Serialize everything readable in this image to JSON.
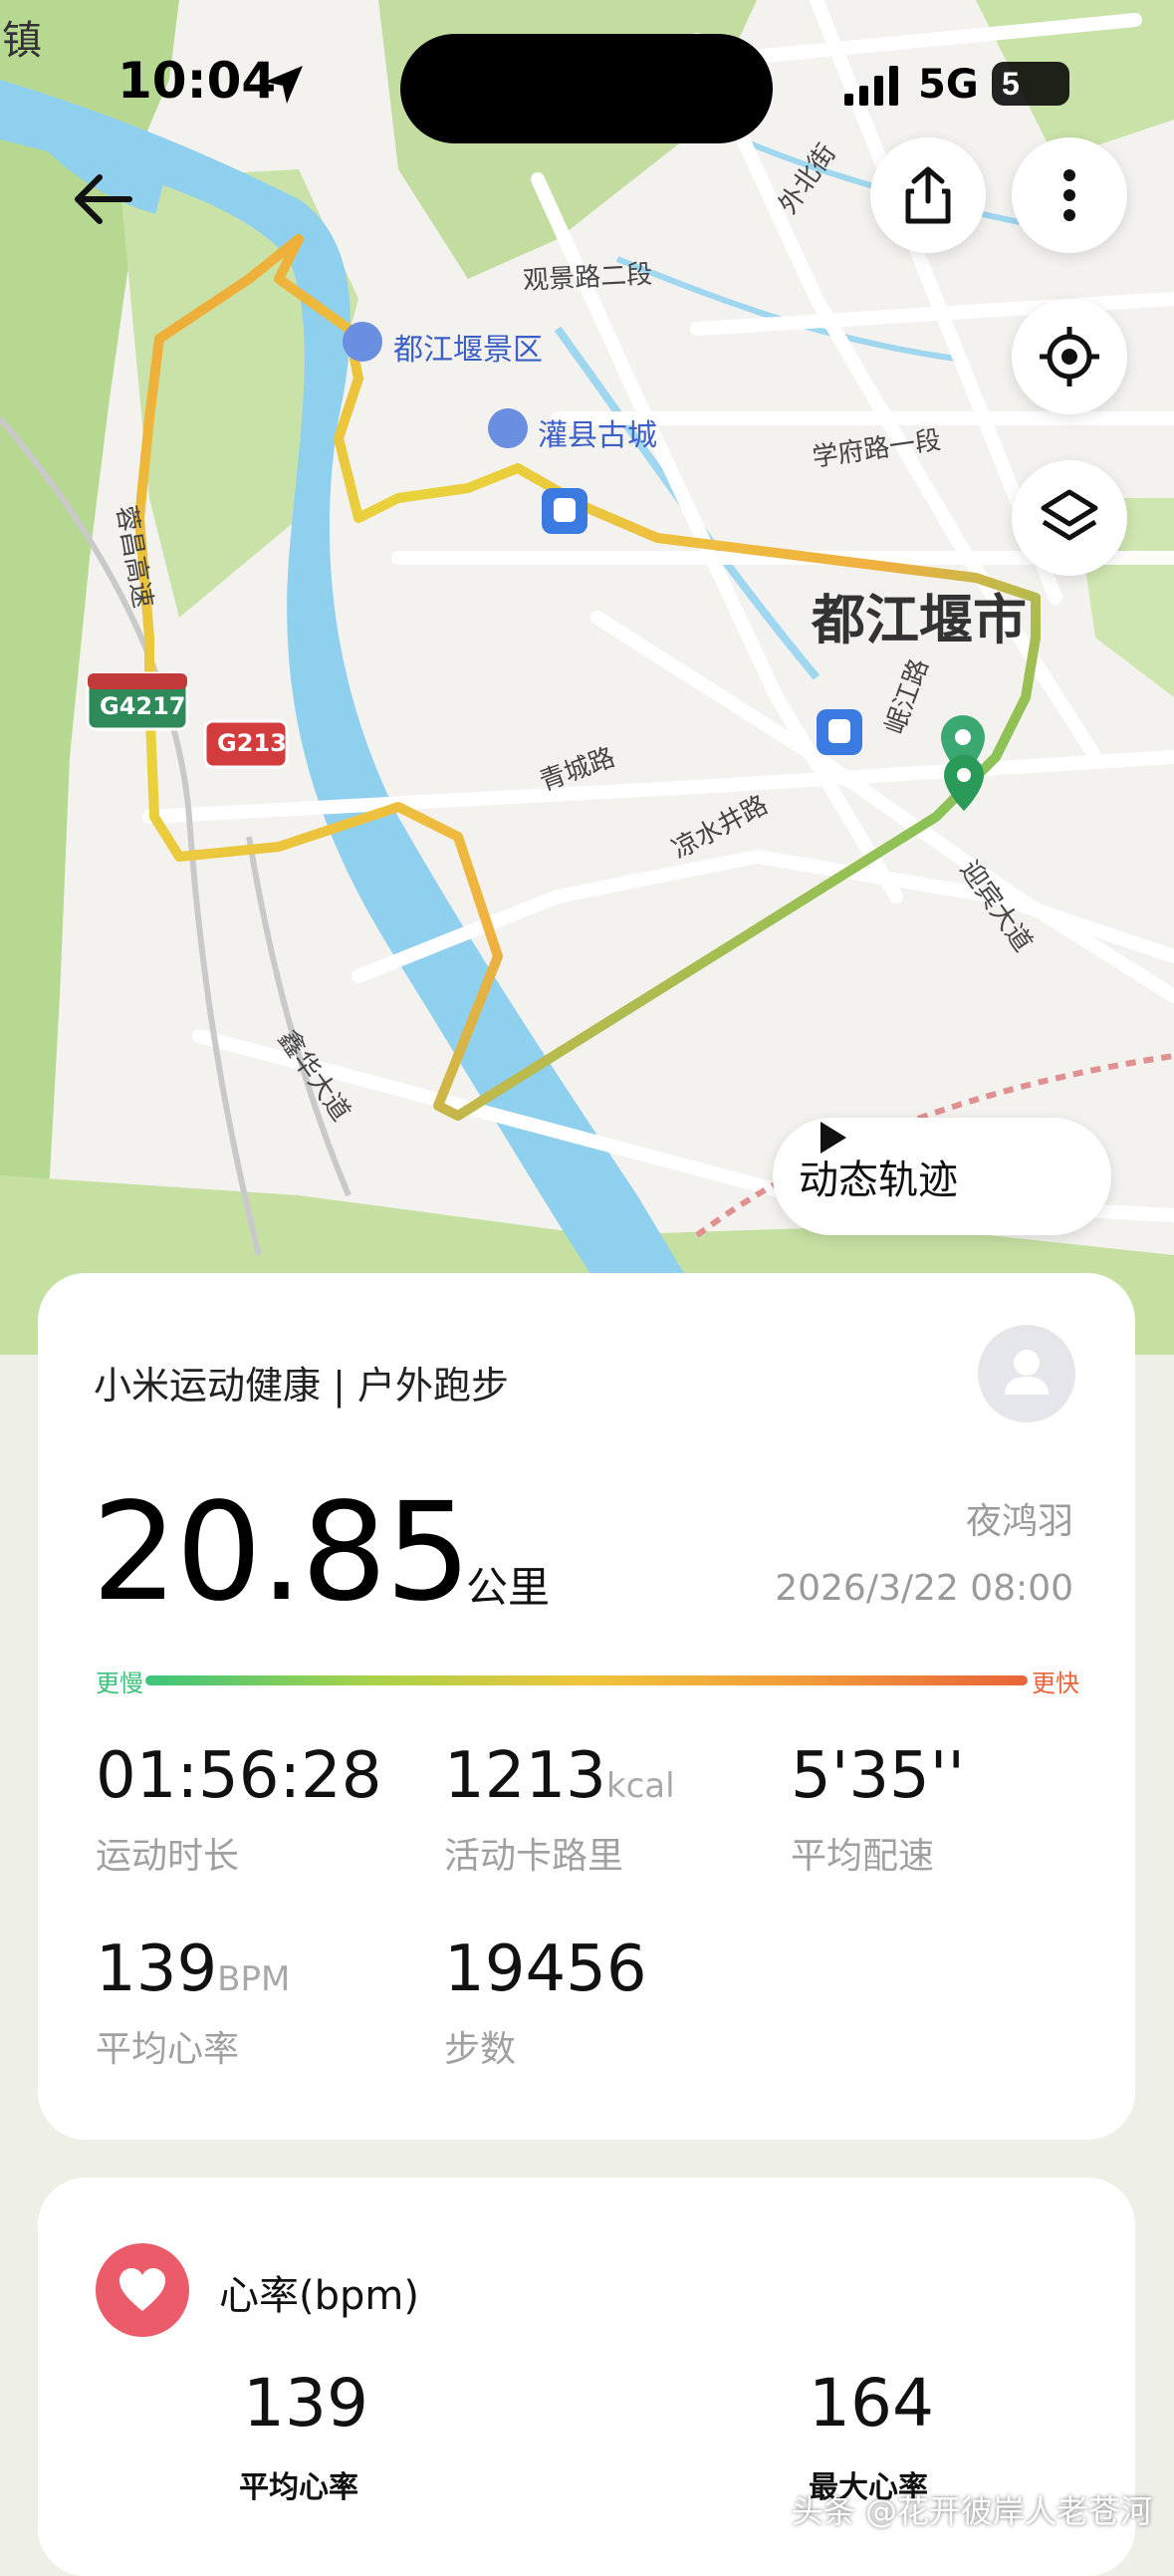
{
  "status_bar": {
    "time": "10:04",
    "network": "5G",
    "battery": "5"
  },
  "map": {
    "labels": {
      "town": "镇",
      "guanjing_road": "观景路二段",
      "waibei_street": "外北街",
      "dujiangyan_scenic": "都江堰景区",
      "guanxian_oldtown": "灌县古城",
      "xuefu_road": "学府路一段",
      "city": "都江堰市",
      "minjiang_road": "岷江路",
      "qingcheng_road": "青城路",
      "liangshuijing_road": "凉水井路",
      "yingbin_avenue": "迎宾大道",
      "xinhua_avenue": "鑫华大道",
      "highway_name": "蓉昌高速",
      "g4217": "G4217",
      "g213": "G213"
    },
    "playback_button": "动态轨迹"
  },
  "workout_card": {
    "source": "小米运动健康 | 户外跑步",
    "distance": "20.85",
    "distance_unit": "公里",
    "user_name": "夜鸿羽",
    "datetime": "2026/3/22 08:00",
    "pace_slow": "更慢",
    "pace_fast": "更快",
    "stats": [
      {
        "value": "01:56:28",
        "unit": "",
        "label": "运动时长"
      },
      {
        "value": "1213",
        "unit": "kcal",
        "label": "活动卡路里"
      },
      {
        "value": "5'35''",
        "unit": "",
        "label": "平均配速"
      },
      {
        "value": "139",
        "unit": "BPM",
        "label": "平均心率"
      },
      {
        "value": "19456",
        "unit": "",
        "label": "步数"
      }
    ]
  },
  "heart_card": {
    "title": "心率(bpm)",
    "avg_value": "139",
    "avg_label": "平均心率",
    "max_value": "164",
    "max_label": "最大心率"
  },
  "watermark": "头条 @花开彼岸人老苍河",
  "colors": {
    "slow": "#3cc47c",
    "mid": "#f0c43a",
    "fast": "#e8643a",
    "heart": "#ec5b6a",
    "river": "#8fd0ee",
    "green": "#bcdc98"
  }
}
